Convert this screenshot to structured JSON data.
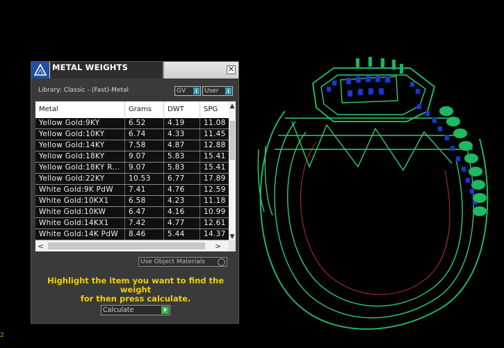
{
  "panel": {
    "title": "METAL WEIGHTS",
    "close_glyph": "✕",
    "library_label": "Library: Classic - (Fast)-Metal",
    "toggles": [
      {
        "label": "GV"
      },
      {
        "label": "User"
      }
    ],
    "table": {
      "columns": [
        "Metal",
        "Grams",
        "DWT",
        "SPG"
      ],
      "rows": [
        {
          "metal": "Yellow Gold:9KY",
          "grams": "6.52",
          "dwt": "4.19",
          "spg": "11.08"
        },
        {
          "metal": "Yellow Gold:10KY",
          "grams": "6.74",
          "dwt": "4.33",
          "spg": "11.45"
        },
        {
          "metal": "Yellow Gold:14KY",
          "grams": "7.58",
          "dwt": "4.87",
          "spg": "12.88"
        },
        {
          "metal": "Yellow Gold:18KY",
          "grams": "9.07",
          "dwt": "5.83",
          "spg": "15.41"
        },
        {
          "metal": "Yellow Gold:18KY R...",
          "grams": "9.07",
          "dwt": "5.83",
          "spg": "15.41"
        },
        {
          "metal": "Yellow Gold:22KY",
          "grams": "10.53",
          "dwt": "6.77",
          "spg": "17.89"
        },
        {
          "metal": "White Gold:9K PdW",
          "grams": "7.41",
          "dwt": "4.76",
          "spg": "12.59"
        },
        {
          "metal": "White Gold:10KX1",
          "grams": "6.58",
          "dwt": "4.23",
          "spg": "11.18"
        },
        {
          "metal": "White Gold:10KW",
          "grams": "6.47",
          "dwt": "4.16",
          "spg": "10.99"
        },
        {
          "metal": "White Gold:14KX1",
          "grams": "7.42",
          "dwt": "4.77",
          "spg": "12.61"
        },
        {
          "metal": "White Gold:14K PdW",
          "grams": "8.46",
          "dwt": "5.44",
          "spg": "14.37"
        }
      ]
    },
    "use_object_materials": "Use Object Materials",
    "instruction_line1": "Highlight the item you want to find the weight",
    "instruction_line2": "for then press calculate.",
    "calculate_label": "Calculate"
  },
  "corner_mark": "2",
  "colors": {
    "background": "#000000",
    "ring_green": "#1fb864",
    "stone_blue": "#1a3ad0",
    "highlight_yellow": "#f0d000",
    "panel_gray": "#3a3a3a"
  }
}
